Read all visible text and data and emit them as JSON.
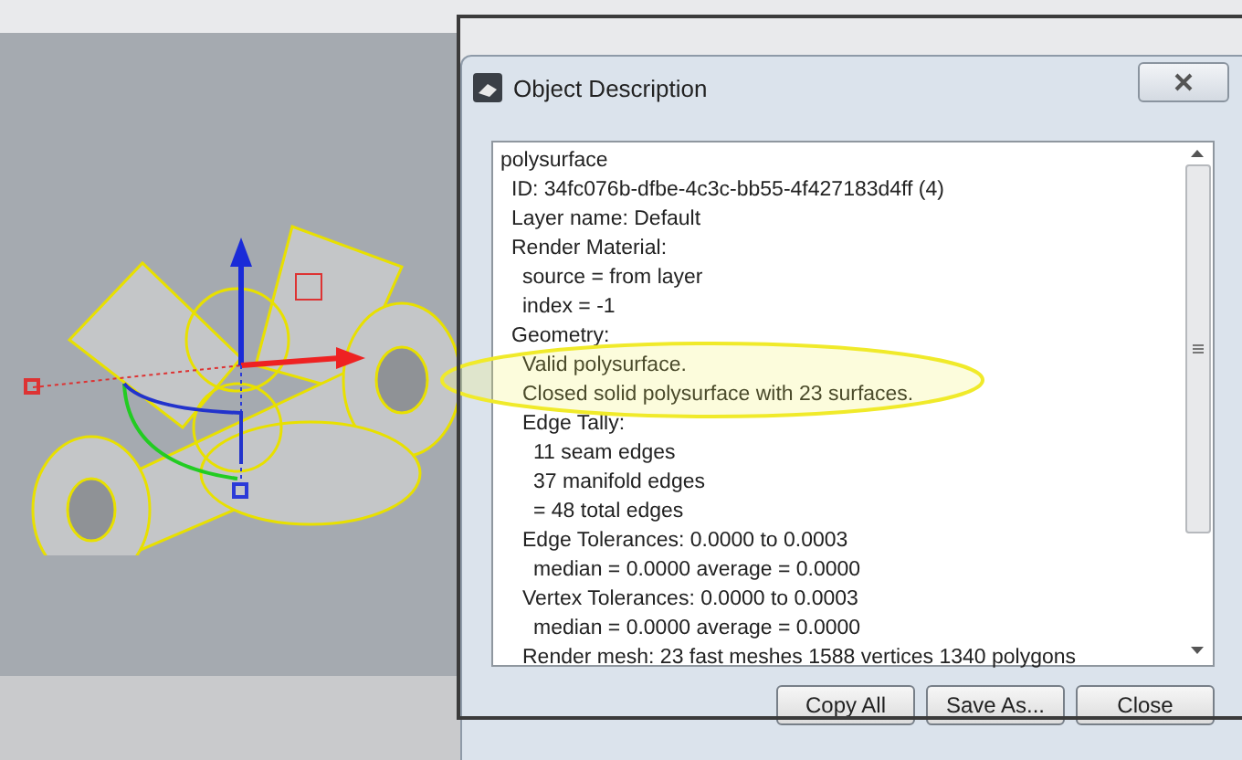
{
  "window": {
    "title": "Object Description"
  },
  "description": [
    {
      "text": "polysurface",
      "children": [
        {
          "text": "ID: 34fc076b-dfbe-4c3c-bb55-4f427183d4ff (4)"
        },
        {
          "text": "Layer name: Default"
        },
        {
          "text": "Render Material:",
          "children": [
            {
              "text": "source = from layer"
            },
            {
              "text": "index = -1"
            }
          ]
        },
        {
          "text": "Geometry:",
          "children": [
            {
              "text": "Valid polysurface."
            },
            {
              "text": "Closed solid polysurface with 23 surfaces."
            },
            {
              "text": "Edge Tally:",
              "children": [
                {
                  "text": "11 seam edges"
                },
                {
                  "text": "37 manifold edges"
                },
                {
                  "text": "= 48 total edges"
                }
              ]
            },
            {
              "text": "Edge Tolerances: 0.0000 to 0.0003",
              "children": [
                {
                  "text": "median = 0.0000 average = 0.0000"
                }
              ]
            },
            {
              "text": "Vertex Tolerances: 0.0000 to 0.0003",
              "children": [
                {
                  "text": "median = 0.0000 average = 0.0000"
                }
              ]
            },
            {
              "text": "Render mesh: 23 fast meshes  1588 vertices  1340 polygons"
            }
          ]
        }
      ]
    }
  ],
  "buttons": [
    "Copy All",
    "Save As...",
    "Close"
  ]
}
